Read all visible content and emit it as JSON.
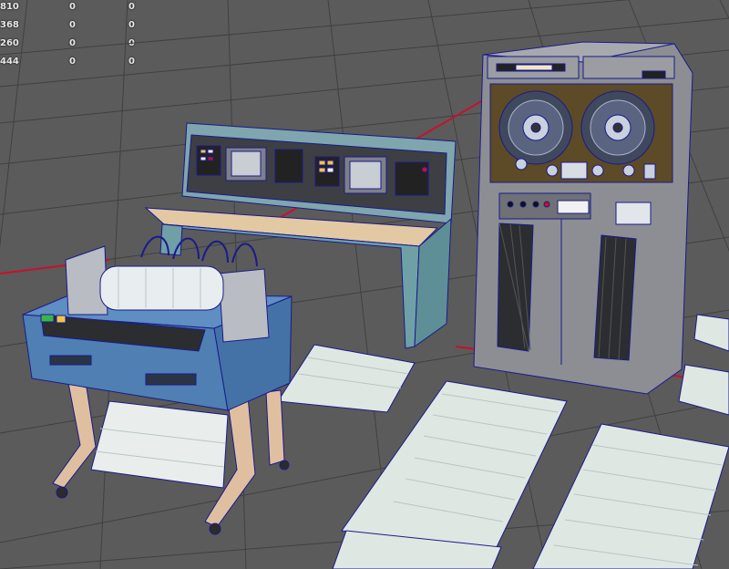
{
  "app": {
    "panel": "3D viewport",
    "view": "perspective",
    "scene": "retro mainframe computer set: tape drive cabinet, operator console, line printer, printout paper sheets"
  },
  "hud_stats": [
    {
      "label": "810",
      "v1": "0",
      "v2": "0"
    },
    {
      "label": "368",
      "v1": "0",
      "v2": "0"
    },
    {
      "label": "260",
      "v1": "0",
      "v2": "0"
    },
    {
      "label": "444",
      "v1": "0",
      "v2": "0"
    }
  ],
  "colors": {
    "viewport_bg": "#5b5b5b",
    "grid_line": "#3e3e3e",
    "axis_x": "#c8102e",
    "wireframe": "#1a1a8c",
    "printer_blue": "#4f7fb3",
    "console_teal": "#6fa0a6",
    "cabinet_gray": "#8c8e94",
    "tape_panel_brown": "#5d4a26",
    "paper_white": "#e4ece8"
  },
  "icons": [
    "tape-reel-icon",
    "crt-screen-icon",
    "switch-panel-icon"
  ]
}
